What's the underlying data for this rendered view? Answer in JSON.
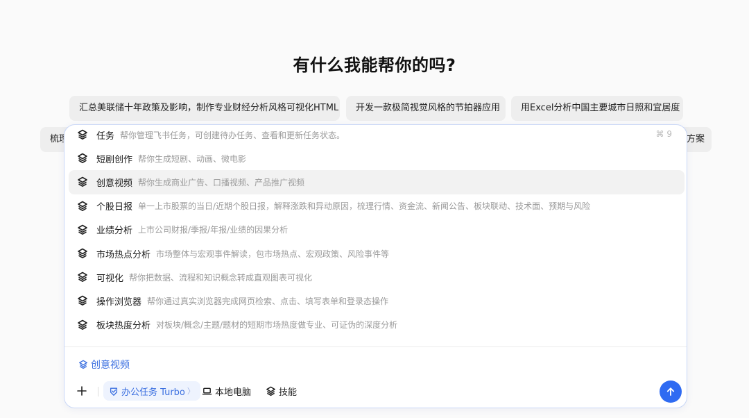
{
  "heading": "有什么我能帮你的吗?",
  "suggestions": [
    "汇总美联储十年政策及影响，制作专业财经分析风格可视化HTML",
    "开发一款极简视觉风格的节拍器应用",
    "用Excel分析中国主要城市日照和宜居度",
    "梳理",
    "方案"
  ],
  "skills": [
    {
      "name": "任务",
      "desc": "帮你管理飞书任务，可创建待办任务、查看和更新任务状态。",
      "shortcut": "⌘ 9"
    },
    {
      "name": "短剧创作",
      "desc": "帮你生成短剧、动画、微电影"
    },
    {
      "name": "创意视频",
      "desc": "帮你生成商业广告、口播视频、产品推广视频"
    },
    {
      "name": "个股日报",
      "desc": "单一上市股票的当日/近期个股日报，解释涨跌和异动原因，梳理行情、资金流、新闻公告、板块联动、技术面、预期与风险"
    },
    {
      "name": "业绩分析",
      "desc": "上市公司财报/季报/年报/业绩的因果分析"
    },
    {
      "name": "市场热点分析",
      "desc": "市场整体与宏观事件解读，包市场热点、宏观政策、风险事件等"
    },
    {
      "name": "可视化",
      "desc": "帮你把数据、流程和知识概念转成直观图表可视化"
    },
    {
      "name": "操作浏览器",
      "desc": "帮你通过真实浏览器完成网页检索、点击、填写表单和登录态操作"
    },
    {
      "name": "板块热度分析",
      "desc": "对板块/概念/主题/题材的短期市场热度做专业、可证伪的深度分析"
    }
  ],
  "selected_skill": "创意视频",
  "toolbar": {
    "mode_label": "办公任务 Turbo",
    "local_label": "本地电脑",
    "skills_label": "技能"
  },
  "colors": {
    "accent": "#2f6bf2",
    "active_row": "#f2f2f2"
  },
  "icons": {
    "skill": "layers-icon",
    "send": "arrow-up-icon",
    "add": "plus-icon",
    "local": "laptop-icon",
    "mode": "office-task-icon"
  }
}
